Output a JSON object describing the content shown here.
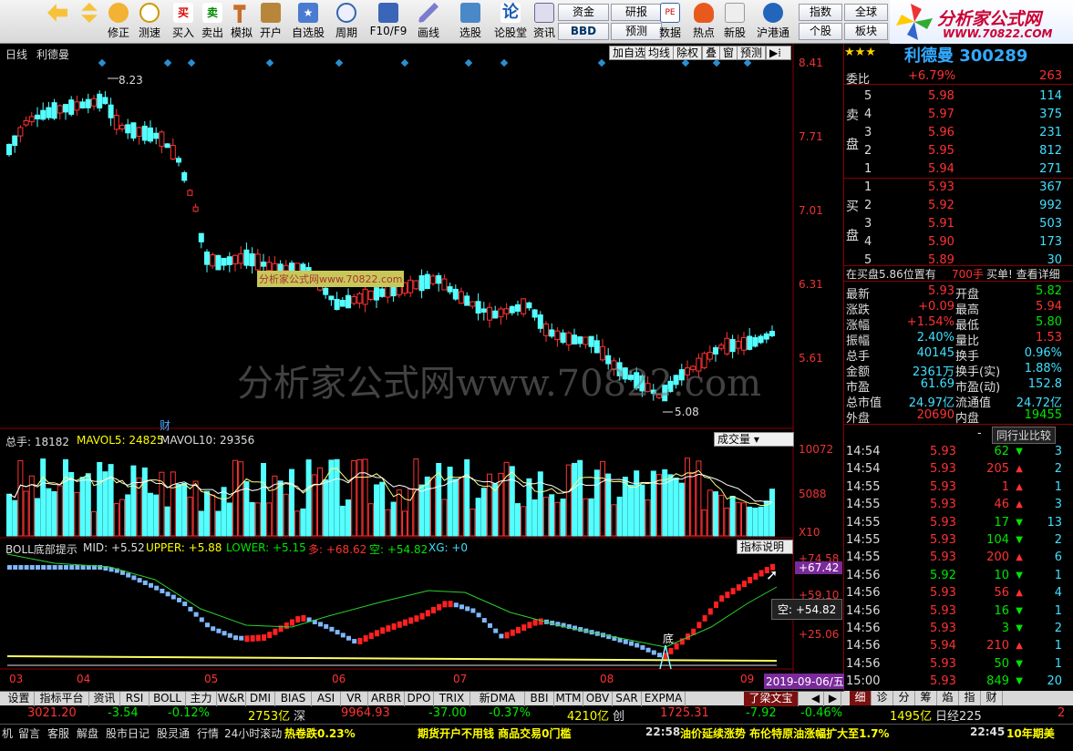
{
  "toolbar": {
    "buttons": [
      {
        "label": "",
        "icon": "back-arrow-icon"
      },
      {
        "label": "",
        "icon": "updown-arrow-icon"
      },
      {
        "label": "修正"
      },
      {
        "label": "测速"
      },
      {
        "label": "买入"
      },
      {
        "label": "卖出"
      },
      {
        "label": "模拟"
      },
      {
        "label": "开户"
      },
      {
        "label": "自选股"
      },
      {
        "label": "周期"
      },
      {
        "label": "F10/F9"
      },
      {
        "label": "画线"
      },
      {
        "label": "选股"
      },
      {
        "label": "论股堂"
      },
      {
        "label": "资讯"
      },
      {
        "label": "数据"
      },
      {
        "label": "热点"
      },
      {
        "label": "新股"
      },
      {
        "label": "沪港通"
      }
    ],
    "small_buttons": [
      "资金",
      "研报",
      "BBD",
      "预测",
      "指数",
      "全球",
      "个股",
      "板块"
    ],
    "logo_title": "分析家公式网",
    "logo_url": "WWW.70822.COM"
  },
  "chart": {
    "period": "日线",
    "stock_name": "利德曼",
    "header_buttons": [
      "加自选",
      "均线",
      "除权",
      "叠",
      "窗",
      "预测"
    ],
    "price_axis": [
      "8.41",
      "7.71",
      "7.01",
      "6.31",
      "5.61"
    ],
    "high_label": "8.23",
    "low_label": "5.08",
    "cai_label": "财",
    "watermark": "分析家公式网www.70822.com",
    "watermark_small": "分析家公式网www.70822.com",
    "volume": {
      "label_total": "总手: 18182",
      "label_ma5": "MAVOL5: 24825",
      "label_ma10": "MAVOL10: 29356",
      "dropdown": "成交量",
      "axis": [
        "10072",
        "5088",
        "X10"
      ]
    },
    "boll": {
      "title": "BOLL底部提示",
      "mid": "MID: +5.52",
      "upper": "UPPER: +5.88",
      "lower": "LOWER: +5.15",
      "duo": "多: +68.62",
      "kong": "空: +54.82",
      "xg": "XG: +0",
      "button": "指标说明",
      "axis": [
        "+74.58",
        "+67.42",
        "+59.10",
        "+25.06"
      ],
      "tooltip": "空: +54.82",
      "di_label": "底"
    },
    "x_axis": [
      "03",
      "04",
      "05",
      "06",
      "07",
      "08",
      "09"
    ],
    "date_label": "2019-09-06/五"
  },
  "quote": {
    "stars": "★★★",
    "title": "利德曼 300289",
    "weibi_label": "委比",
    "weibi": "+6.79%",
    "weibi_diff": "263",
    "sell": [
      {
        "n": "5",
        "p": "5.98",
        "v": "114"
      },
      {
        "n": "4",
        "p": "5.97",
        "v": "375"
      },
      {
        "n": "3",
        "p": "5.96",
        "v": "231"
      },
      {
        "n": "2",
        "p": "5.95",
        "v": "812"
      },
      {
        "n": "1",
        "p": "5.94",
        "v": "271"
      }
    ],
    "buy": [
      {
        "n": "1",
        "p": "5.93",
        "v": "367"
      },
      {
        "n": "2",
        "p": "5.92",
        "v": "992"
      },
      {
        "n": "3",
        "p": "5.91",
        "v": "503"
      },
      {
        "n": "4",
        "p": "5.90",
        "v": "173"
      },
      {
        "n": "5",
        "p": "5.89",
        "v": "30"
      }
    ],
    "sell_label": "卖",
    "sell_label2": "盘",
    "buy_label": "买",
    "buy_label2": "盘",
    "notice": "在买盘5.86位置有",
    "notice_vol": "700手",
    "notice_link": "买单! 查看详细",
    "stats": [
      {
        "k": "最新",
        "v": "5.93",
        "k2": "开盘",
        "v2": "5.82"
      },
      {
        "k": "涨跌",
        "v": "+0.09",
        "k2": "最高",
        "v2": "5.94"
      },
      {
        "k": "涨幅",
        "v": "+1.54%",
        "k2": "最低",
        "v2": "5.80"
      },
      {
        "k": "振幅",
        "v": "2.40%",
        "k2": "量比",
        "v2": "1.53"
      },
      {
        "k": "总手",
        "v": "40145",
        "k2": "换手",
        "v2": "0.96%"
      },
      {
        "k": "金额",
        "v": "2361万",
        "k2": "换手(实)",
        "v2": "1.88%"
      },
      {
        "k": "市盈",
        "v": "61.69",
        "k2": "市盈(动)",
        "v2": "152.8"
      },
      {
        "k": "总市值",
        "v": "24.97亿",
        "k2": "流通值",
        "v2": "24.72亿"
      },
      {
        "k": "外盘",
        "v": "20690",
        "k2": "内盘",
        "v2": "19455"
      }
    ],
    "compare_btn": "同行业比较",
    "compare_dash": "-",
    "ticks": [
      {
        "t": "14:54",
        "p": "5.93",
        "v": "62",
        "d": "down",
        "n": "3"
      },
      {
        "t": "14:54",
        "p": "5.93",
        "v": "205",
        "d": "up",
        "n": "2"
      },
      {
        "t": "14:55",
        "p": "5.93",
        "v": "1",
        "d": "up",
        "n": "1"
      },
      {
        "t": "14:55",
        "p": "5.93",
        "v": "46",
        "d": "up",
        "n": "3"
      },
      {
        "t": "14:55",
        "p": "5.93",
        "v": "17",
        "d": "down",
        "n": "13"
      },
      {
        "t": "14:55",
        "p": "5.93",
        "v": "104",
        "d": "down",
        "n": "2"
      },
      {
        "t": "14:55",
        "p": "5.93",
        "v": "200",
        "d": "up",
        "n": "6"
      },
      {
        "t": "14:56",
        "p": "5.92",
        "v": "10",
        "d": "down",
        "n": "1"
      },
      {
        "t": "14:56",
        "p": "5.93",
        "v": "56",
        "d": "up",
        "n": "4"
      },
      {
        "t": "14:56",
        "p": "5.93",
        "v": "16",
        "d": "down",
        "n": "1"
      },
      {
        "t": "14:56",
        "p": "5.93",
        "v": "3",
        "d": "down",
        "n": "2"
      },
      {
        "t": "14:56",
        "p": "5.94",
        "v": "210",
        "d": "up",
        "n": "1"
      },
      {
        "t": "14:56",
        "p": "5.93",
        "v": "50",
        "d": "down",
        "n": "1"
      },
      {
        "t": "15:00",
        "p": "5.93",
        "v": "849",
        "d": "down",
        "n": "20"
      }
    ],
    "side_tabs": [
      "细",
      "诊",
      "分",
      "筹",
      "焰",
      "指",
      "财"
    ]
  },
  "tabs": [
    "设置",
    "指标平台",
    "资讯",
    "RSI",
    "BOLL",
    "主力",
    "W&R",
    "DMI",
    "BIAS",
    "ASI",
    "VR",
    "ARBR",
    "DPO",
    "TRIX",
    "新DMA",
    "BBI",
    "MTM",
    "OBV",
    "SAR",
    "EXPMA"
  ],
  "tab_active": "了梁文宝",
  "market": {
    "sh_val": "3021.20",
    "sh_chg": "-3.54",
    "sh_pct": "-0.12%",
    "sh_amt": "2753亿",
    "sz_name": "深",
    "sz_val": "9964.93",
    "sz_chg": "-37.00",
    "sz_pct": "-0.37%",
    "sz_amt": "4210亿",
    "cy_name": "创",
    "cy_val": "1725.31",
    "cy_chg": "-7.92",
    "cy_pct": "-0.46%",
    "cy_amt": "1495亿",
    "nk_name": "日经225",
    "nk_val": "2"
  },
  "status": {
    "items": [
      "机",
      "留言",
      "客服",
      "解盘",
      "股市日记",
      "股灵通",
      "行情",
      "24小时滚动"
    ],
    "news1": "热卷跌0.23%",
    "news2": "期货开户不用钱 商品交易0门槛",
    "time1": "22:58",
    "news3": "油价延续涨势 布伦特原油涨幅扩大至1.7%",
    "time2": "22:45",
    "news4": "10年期美"
  }
}
